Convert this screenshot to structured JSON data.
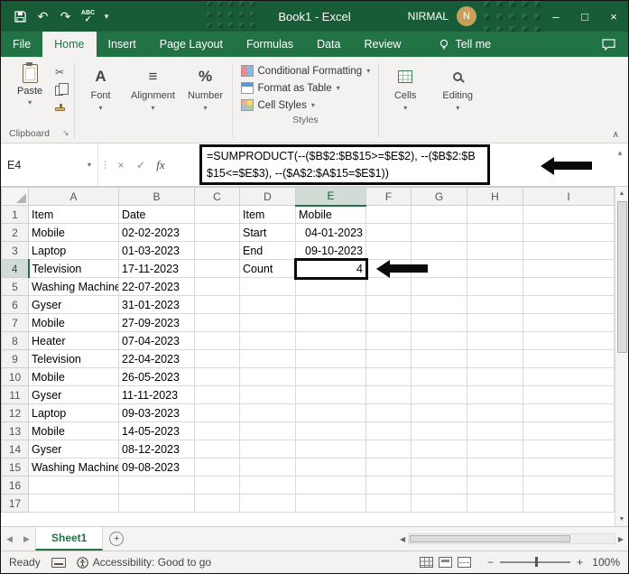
{
  "window": {
    "title": "Book1 - Excel",
    "user": "NIRMAL",
    "avatar": "N"
  },
  "menu": {
    "tabs": [
      "File",
      "Home",
      "Insert",
      "Page Layout",
      "Formulas",
      "Data",
      "Review"
    ],
    "active_tab": "Home",
    "tell_me": "Tell me"
  },
  "ribbon": {
    "paste": "Paste",
    "clipboard": "Clipboard",
    "font": "Font",
    "alignment": "Alignment",
    "number": "Number",
    "conditional_formatting": "Conditional Formatting",
    "format_as_table": "Format as Table",
    "cell_styles": "Cell Styles",
    "styles": "Styles",
    "cells": "Cells",
    "editing": "Editing"
  },
  "formula_bar": {
    "name_box": "E4",
    "formula": "=SUMPRODUCT(--($B$2:$B$15>=$E$2), --($B$2:$B$15<=$E$3), --($A$2:$A$15=$E$1))"
  },
  "grid": {
    "columns": [
      "A",
      "B",
      "C",
      "D",
      "E",
      "F",
      "G",
      "H",
      "I"
    ],
    "selected": {
      "column": "E",
      "row": 4
    },
    "rows": [
      [
        "Item",
        "Date",
        "",
        "Item",
        "Mobile",
        "",
        "",
        "",
        ""
      ],
      [
        "Mobile",
        "02-02-2023",
        "",
        "Start",
        "04-01-2023",
        "",
        "",
        "",
        ""
      ],
      [
        "Laptop",
        "01-03-2023",
        "",
        "End",
        "09-10-2023",
        "",
        "",
        "",
        ""
      ],
      [
        "Television",
        "17-11-2023",
        "",
        "Count",
        "4",
        "",
        "",
        "",
        ""
      ],
      [
        "Washing Machine",
        "22-07-2023",
        "",
        "",
        "",
        "",
        "",
        "",
        ""
      ],
      [
        "Gyser",
        "31-01-2023",
        "",
        "",
        "",
        "",
        "",
        "",
        ""
      ],
      [
        "Mobile",
        "27-09-2023",
        "",
        "",
        "",
        "",
        "",
        "",
        ""
      ],
      [
        "Heater",
        "07-04-2023",
        "",
        "",
        "",
        "",
        "",
        "",
        ""
      ],
      [
        "Television",
        "22-04-2023",
        "",
        "",
        "",
        "",
        "",
        "",
        ""
      ],
      [
        "Mobile",
        "26-05-2023",
        "",
        "",
        "",
        "",
        "",
        "",
        ""
      ],
      [
        "Gyser",
        "11-11-2023",
        "",
        "",
        "",
        "",
        "",
        "",
        ""
      ],
      [
        "Laptop",
        "09-03-2023",
        "",
        "",
        "",
        "",
        "",
        "",
        ""
      ],
      [
        "Mobile",
        "14-05-2023",
        "",
        "",
        "",
        "",
        "",
        "",
        ""
      ],
      [
        "Gyser",
        "08-12-2023",
        "",
        "",
        "",
        "",
        "",
        "",
        ""
      ],
      [
        "Washing Machine",
        "09-08-2023",
        "",
        "",
        "",
        "",
        "",
        "",
        ""
      ],
      [
        "",
        "",
        "",
        "",
        "",
        "",
        "",
        "",
        ""
      ],
      [
        "",
        "",
        "",
        "",
        "",
        "",
        "",
        "",
        ""
      ]
    ]
  },
  "sheet_bar": {
    "active_tab": "Sheet1"
  },
  "status_bar": {
    "mode": "Ready",
    "accessibility": "Accessibility: Good to go",
    "zoom": "100%"
  },
  "icons": {
    "undo": "↶",
    "redo": "↷",
    "dropdown": "▾",
    "spelling": "ABC",
    "spelling_check": "✓",
    "minimize": "–",
    "maximize": "□",
    "close": "×",
    "cut": "✂",
    "dialog_launcher": "↘",
    "collapse_ribbon": "∧",
    "dots": "⋮",
    "cancel": "×",
    "check": "✓",
    "fx": "fx",
    "expand_formula": "▴",
    "font_big": "A",
    "alignment_big": "≡",
    "number_big": "%",
    "scroll_up": "▲",
    "scroll_down": "▼",
    "nav_left": "◀",
    "nav_right": "▶",
    "add_sheet": "+",
    "zoom_out": "−",
    "zoom_in": "+"
  }
}
